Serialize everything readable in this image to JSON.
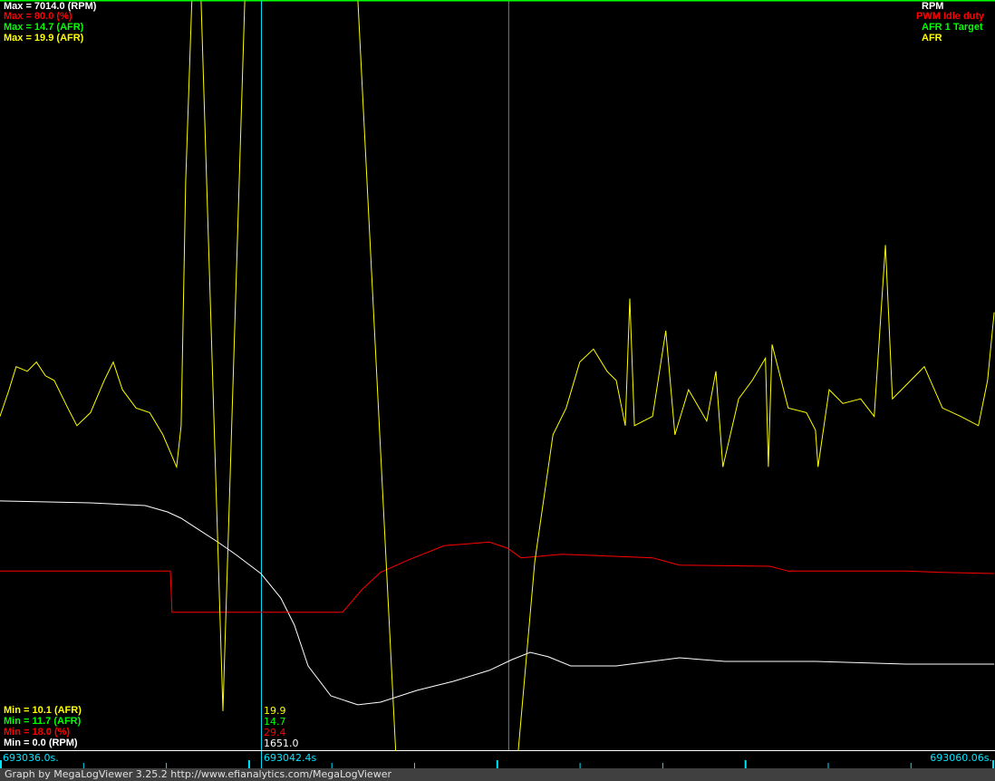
{
  "chart_data": {
    "type": "line",
    "time_start_label": "693036.0s.",
    "time_end_label": "693060.06s.",
    "cursor_label": "693042.4s",
    "time_range_s": [
      0,
      24.06
    ],
    "cursor_time_s": 6.31,
    "marker_time_s": 12.29,
    "series": [
      {
        "name": "RPM",
        "color": "#ffffff",
        "unit": "RPM",
        "range": [
          0.0,
          7014.0
        ],
        "max_label": "Max = 7014.0 (RPM)",
        "min_label": "Min = 0.0 (RPM)",
        "cursor_value": "1651.0",
        "t": [
          0,
          2.19,
          3.51,
          4.05,
          4.38,
          4.82,
          5.26,
          5.7,
          6.31,
          6.79,
          7.12,
          7.45,
          8.0,
          8.65,
          9.2,
          10.08,
          10.96,
          11.83,
          12.38,
          12.82,
          13.26,
          13.8,
          14.9,
          16.43,
          17.53,
          19.72,
          21.91,
          24.04
        ],
        "v": [
          2330,
          2313,
          2287,
          2228,
          2169,
          2058,
          1948,
          1830,
          1651,
          1423,
          1169,
          788,
          508,
          424,
          449,
          559,
          644,
          746,
          847,
          915,
          873,
          788,
          788,
          864,
          830,
          830,
          805,
          805
        ]
      },
      {
        "name": "PWM Idle duty",
        "color": "#ff0000",
        "unit": "%",
        "range": [
          18.0,
          80.0
        ],
        "max_label": "Max = 80.0 (%)",
        "min_label": "Min = 18.0 (%)",
        "cursor_value": "29.4",
        "t": [
          0,
          4.12,
          4.16,
          8.28,
          8.76,
          9.2,
          9.86,
          10.74,
          11.83,
          12.27,
          12.6,
          13.58,
          15.78,
          16.43,
          18.62,
          19.06,
          21.91,
          22.79,
          24.04
        ],
        "v": [
          32.8,
          32.8,
          29.4,
          29.4,
          31.3,
          32.7,
          33.7,
          34.9,
          35.2,
          34.7,
          33.9,
          34.2,
          33.9,
          33.3,
          33.2,
          32.8,
          32.8,
          32.7,
          32.6
        ]
      },
      {
        "name": "AFR 1 Target",
        "color": "#00ff00",
        "unit": "AFR",
        "range": [
          11.7,
          14.7
        ],
        "max_label": "Max = 14.7 (AFR)",
        "min_label": "Min = 11.7 (AFR)",
        "cursor_value": "14.7",
        "t": [
          0,
          24.06
        ],
        "v": [
          14.7,
          14.7
        ]
      },
      {
        "name": "AFR",
        "color": "#ffff00",
        "unit": "AFR",
        "range": [
          10.1,
          19.9
        ],
        "max_label": "Max = 19.9 (AFR)",
        "min_label": "Min = 10.1 (AFR)",
        "cursor_value": "19.9",
        "t": [
          0,
          0.22,
          0.39,
          0.66,
          0.88,
          1.1,
          1.31,
          1.64,
          1.86,
          2.19,
          2.52,
          2.74,
          2.96,
          3.29,
          3.62,
          3.94,
          4.27,
          4.38,
          4.49,
          4.64,
          4.86,
          5.39,
          5.92,
          8.65,
          9.57,
          12.53,
          12.93,
          13.37,
          13.69,
          14.02,
          14.35,
          14.68,
          14.9,
          15.12,
          15.23,
          15.34,
          15.78,
          16.1,
          16.32,
          16.65,
          17.09,
          17.31,
          17.48,
          17.86,
          18.19,
          18.51,
          18.58,
          18.67,
          19.06,
          19.5,
          19.72,
          19.78,
          20.05,
          20.38,
          20.81,
          21.14,
          21.41,
          21.58,
          21.91,
          22.35,
          22.79,
          23.23,
          23.66,
          23.88,
          24.04
        ],
        "v": [
          14.46,
          14.81,
          15.11,
          15.05,
          15.17,
          14.99,
          14.93,
          14.57,
          14.34,
          14.51,
          14.93,
          15.17,
          14.81,
          14.57,
          14.51,
          14.22,
          13.8,
          14.34,
          17.53,
          21.5,
          21.5,
          10.61,
          21.5,
          21.5,
          8.5,
          8.5,
          12.56,
          14.22,
          14.57,
          15.17,
          15.34,
          15.05,
          14.93,
          14.34,
          16.0,
          14.34,
          14.46,
          15.58,
          14.22,
          14.81,
          14.4,
          15.05,
          13.8,
          14.69,
          14.93,
          15.22,
          13.8,
          15.4,
          14.57,
          14.51,
          14.28,
          13.8,
          14.81,
          14.63,
          14.69,
          14.46,
          16.7,
          14.69,
          14.87,
          15.11,
          14.57,
          14.46,
          14.34,
          14.93,
          15.82
        ]
      }
    ]
  },
  "footer": "Graph by MegaLogViewer 3.25.2 http://www.efianalytics.com/MegaLogViewer"
}
